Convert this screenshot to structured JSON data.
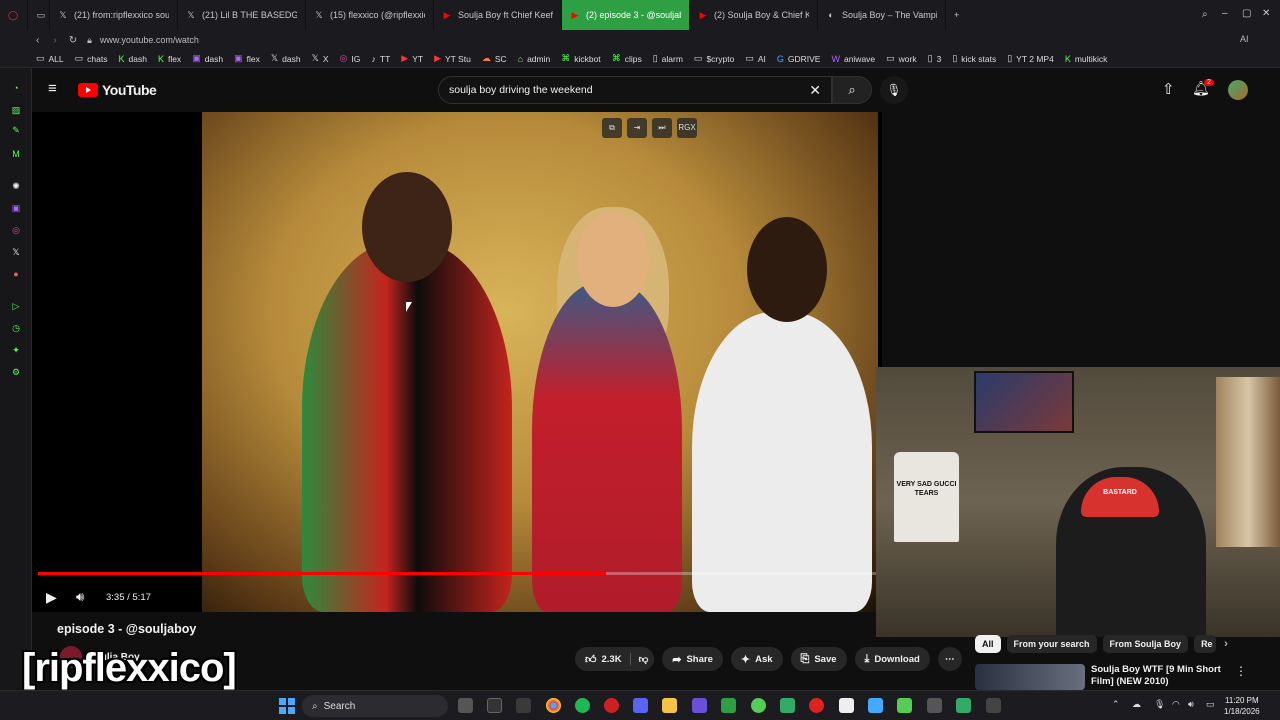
{
  "browser": {
    "tabs": [
      {
        "title": "(21) from:ripflexxico soulja",
        "icon": "x-logo-icon",
        "active": false
      },
      {
        "title": "(21) Lil B THE BASEDGOD",
        "icon": "x-logo-icon",
        "active": false
      },
      {
        "title": "(15) flexxico (@ripflexxico",
        "icon": "x-logo-icon",
        "active": false
      },
      {
        "title": "Soulja Boy ft Chief Keef -",
        "icon": "youtube-icon",
        "active": false
      },
      {
        "title": "(2) episode 3 - @souljabo",
        "icon": "youtube-icon",
        "active": true
      },
      {
        "title": "(2) Soulja Boy & Chief Kee",
        "icon": "youtube-icon",
        "active": false
      },
      {
        "title": "Soulja Boy – The Vampire",
        "icon": "site-icon",
        "active": false
      }
    ],
    "new_tab": "+",
    "url": "www.youtube.com/watch",
    "bookmarks": [
      "ALL",
      "chats",
      "dash",
      "flex",
      "dash",
      "flex",
      "dash",
      "X",
      "IG",
      "TT",
      "YT",
      "YT Stu",
      "SC",
      "admin",
      "kickbot",
      "clips",
      "alarm",
      "$crypto",
      "AI",
      "GDRIVE",
      "aniwave",
      "work",
      "3",
      "kick stats",
      "YT 2 MP4",
      "multikick"
    ],
    "right_label": "AI"
  },
  "youtube": {
    "logo": "YouTube",
    "search_query": "soulja boy driving the weekend",
    "notification_count": "2",
    "player": {
      "current_time": "3:35",
      "duration": "5:17",
      "time_display": "3:35 / 5:17",
      "overlay_buttons": [
        "miniplayer",
        "pip",
        "skip",
        "RGX"
      ],
      "overlay_rgx": "RGX"
    },
    "video_title": "episode 3 - @souljaboy",
    "channel_name": "Soulja Boy",
    "actions": {
      "like_count": "2.3K",
      "share": "Share",
      "ask": "Ask",
      "save": "Save",
      "download": "Download"
    },
    "chips": [
      "All",
      "From your search",
      "From Soulja Boy",
      "Re"
    ],
    "recommendation": {
      "title": "Soulja Boy  WTF [9 Min Short Film] (NEW 2010)"
    }
  },
  "webcam": {
    "shirt_text": "VERY SAD GUCCI TEARS",
    "cap_text": "BASTARD"
  },
  "overlay_text": "[ripflexxico]",
  "taskbar": {
    "search_label": "Search",
    "time": "11:20 PM",
    "date": "1/18/2026"
  },
  "colors": {
    "accent_red": "#ff0000",
    "active_tab": "#2ea043",
    "windows_blue": "#4aa8ff"
  }
}
